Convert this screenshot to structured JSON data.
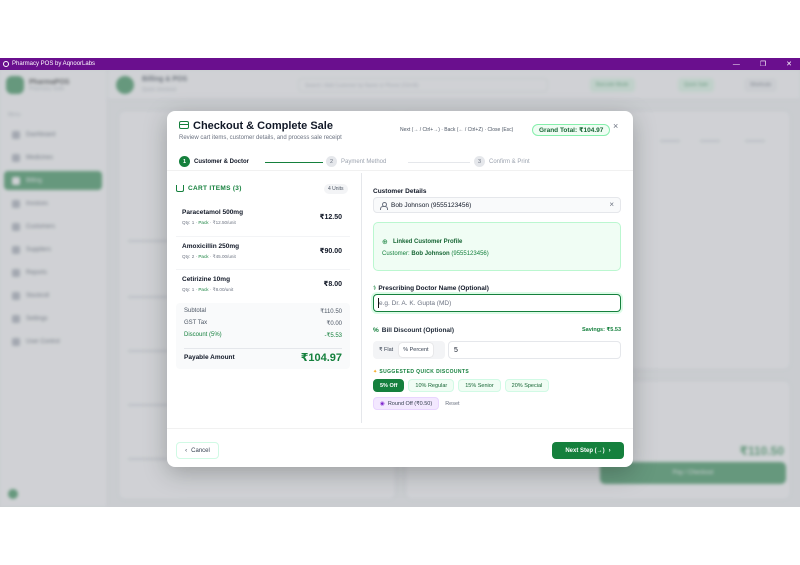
{
  "window": {
    "title": "Pharmacy POS by AqnoorLabs",
    "controls": [
      "—",
      "❐",
      "✕"
    ]
  },
  "background": {
    "brand_title": "PharmaPOS",
    "brand_sub": "Pharmacy Suite",
    "menu_head": "Menu",
    "sidebar_items": [
      "Dashboard",
      "Medicines",
      "Billing",
      "Invoices",
      "Customers",
      "Suppliers",
      "Reports",
      "Stockroll",
      "Settings",
      "User Control"
    ],
    "active_index": 2,
    "top_title": "Billing & POS",
    "top_sub": "Quick checkout",
    "search_placeholder": "Search / Add Customer by Name or Phone (Ctrl+B)",
    "top_btn1": "Barcode Mode",
    "top_btn2": "Quick Sale",
    "top_btn3": "Shortcuts",
    "bg_total": "₹110.50",
    "bg_pay": "Pay / Checkout"
  },
  "modal": {
    "title": "Checkout & Complete Sale",
    "subtitle": "Review cart items, customer details, and process sale receipt",
    "keys_hint": "Next (→ / Ctrl+→) · Back (← / Ctrl+Z) · Close (Esc)",
    "grand_total": "Grand Total: ₹104.97",
    "close_glyph": "×",
    "steps": [
      {
        "num": "1",
        "label": "Customer & Doctor"
      },
      {
        "num": "2",
        "label": "Payment Method"
      },
      {
        "num": "3",
        "label": "Confirm & Print"
      }
    ],
    "cart": {
      "heading": "CART ITEMS (3)",
      "units_badge": "4 Units",
      "items": [
        {
          "name": "Paracetamol 500mg",
          "qty": "Qty: 1",
          "unit": "Pack",
          "rate": "₹12.50/unit",
          "price": "₹12.50"
        },
        {
          "name": "Amoxicillin 250mg",
          "qty": "Qty: 2",
          "unit": "Pack",
          "rate": "₹45.00/unit",
          "price": "₹90.00"
        },
        {
          "name": "Cetirizine 10mg",
          "qty": "Qty: 1",
          "unit": "Pack",
          "rate": "₹8.00/unit",
          "price": "₹8.00"
        }
      ],
      "summary": {
        "subtotal_label": "Subtotal",
        "subtotal": "₹110.50",
        "tax_label": "GST Tax",
        "tax": "₹0.00",
        "discount_label": "Discount (5%)",
        "discount": "-₹5.53",
        "payable_label": "Payable Amount",
        "payable": "₹104.97"
      }
    },
    "customer": {
      "label": "Customer Details",
      "value": "Bob Johnson (9555123456)",
      "clear_glyph": "×",
      "linked_title": "Linked Customer Profile",
      "linked_prefix": "Customer:",
      "linked_name": "Bob Johnson",
      "linked_phone": "(9555123456)"
    },
    "doctor": {
      "label": "Prescribing Doctor Name (Optional)",
      "placeholder": "e.g. Dr. A. K. Gupta (MD)"
    },
    "discount": {
      "label": "Bill Discount (Optional)",
      "savings": "Savings: ₹5.53",
      "mode_flat": "₹ Flat",
      "mode_percent": "% Percent",
      "value": "5",
      "suggest_head": "SUGGESTED QUICK DISCOUNTS",
      "chips": [
        "5% Off",
        "10% Regular",
        "15% Senior",
        "20% Special"
      ],
      "round_off": "Round Off (₹0.50)",
      "reset": "Reset"
    },
    "footer": {
      "cancel": "Cancel",
      "next": "Next Step (→)"
    }
  },
  "colors": {
    "accent": "#15803d",
    "titlebar": "#6a0f8e"
  }
}
